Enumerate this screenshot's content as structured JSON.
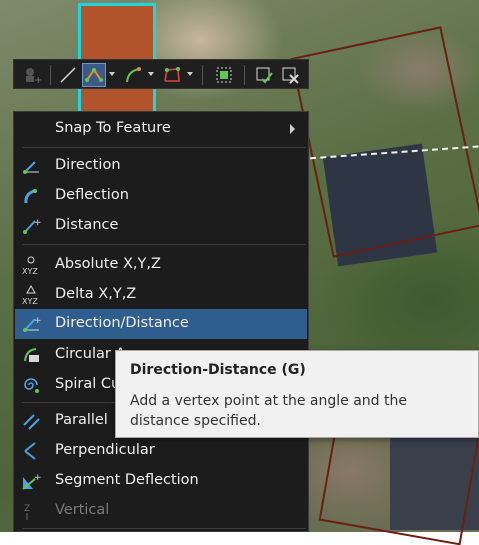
{
  "toolbar": {
    "buttons": [
      {
        "name": "add-point-icon"
      },
      {
        "name": "line-tool-icon"
      },
      {
        "name": "construct-vertices-icon",
        "selected": true
      },
      {
        "name": "arc-tool-icon"
      },
      {
        "name": "polyline-tool-icon"
      },
      {
        "name": "select-features-icon"
      },
      {
        "name": "finish-sketch-icon"
      },
      {
        "name": "delete-sketch-icon"
      }
    ]
  },
  "menu": {
    "snap_to_feature": "Snap To Feature",
    "direction": "Direction",
    "deflection": "Deflection",
    "distance": "Distance",
    "absolute_xyz": "Absolute X,Y,Z",
    "delta_xyz": "Delta X,Y,Z",
    "direction_distance": "Direction/Distance",
    "circular_arc": "Circular A",
    "spiral_curve": "Spiral Cur",
    "parallel": "Parallel",
    "perpendicular": "Perpendicular",
    "segment_deflection": "Segment Deflection",
    "vertical": "Vertical",
    "xyz_glyph": "XYZ"
  },
  "tooltip": {
    "title": "Direction-Distance (G)",
    "body": "Add a vertex point at the angle and the distance specified."
  },
  "colors": {
    "accent_highlight": "#2f5d8e",
    "selected_feature_fill": "#b1542c",
    "selected_feature_outline": "#1ed6e0",
    "menu_background": "#1c1c1c"
  }
}
